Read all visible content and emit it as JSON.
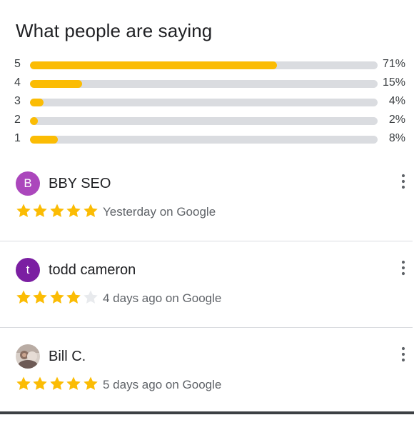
{
  "section_title": "What people are saying",
  "rating_distribution": [
    {
      "stars": "5",
      "percent_label": "71%",
      "fraction": 0.71
    },
    {
      "stars": "4",
      "percent_label": "15%",
      "fraction": 0.15
    },
    {
      "stars": "3",
      "percent_label": "4%",
      "fraction": 0.04
    },
    {
      "stars": "2",
      "percent_label": "2%",
      "fraction": 0.02
    },
    {
      "stars": "1",
      "percent_label": "8%",
      "fraction": 0.08
    }
  ],
  "reviews": [
    {
      "initial": "B",
      "name": "BBY SEO",
      "avatar_color": "#ab47bc",
      "rating": 5,
      "time": "Yesterday on Google"
    },
    {
      "initial": "t",
      "name": "todd cameron",
      "avatar_color": "#7b1fa2",
      "rating": 4,
      "time": "4 days ago on Google"
    },
    {
      "initial": "",
      "name": "Bill C.",
      "avatar_color": "#c9bfb8",
      "rating": 5,
      "time": "5 days ago on Google"
    }
  ],
  "colors": {
    "bar_fill": "#fbbc04",
    "bar_track": "#dadce0",
    "star_filled": "#fbbc04",
    "star_empty": "#e8eaed"
  },
  "icons": {
    "more": "more-vert-icon",
    "star": "star-icon",
    "photo_avatar": "profile-photo-avatar"
  }
}
